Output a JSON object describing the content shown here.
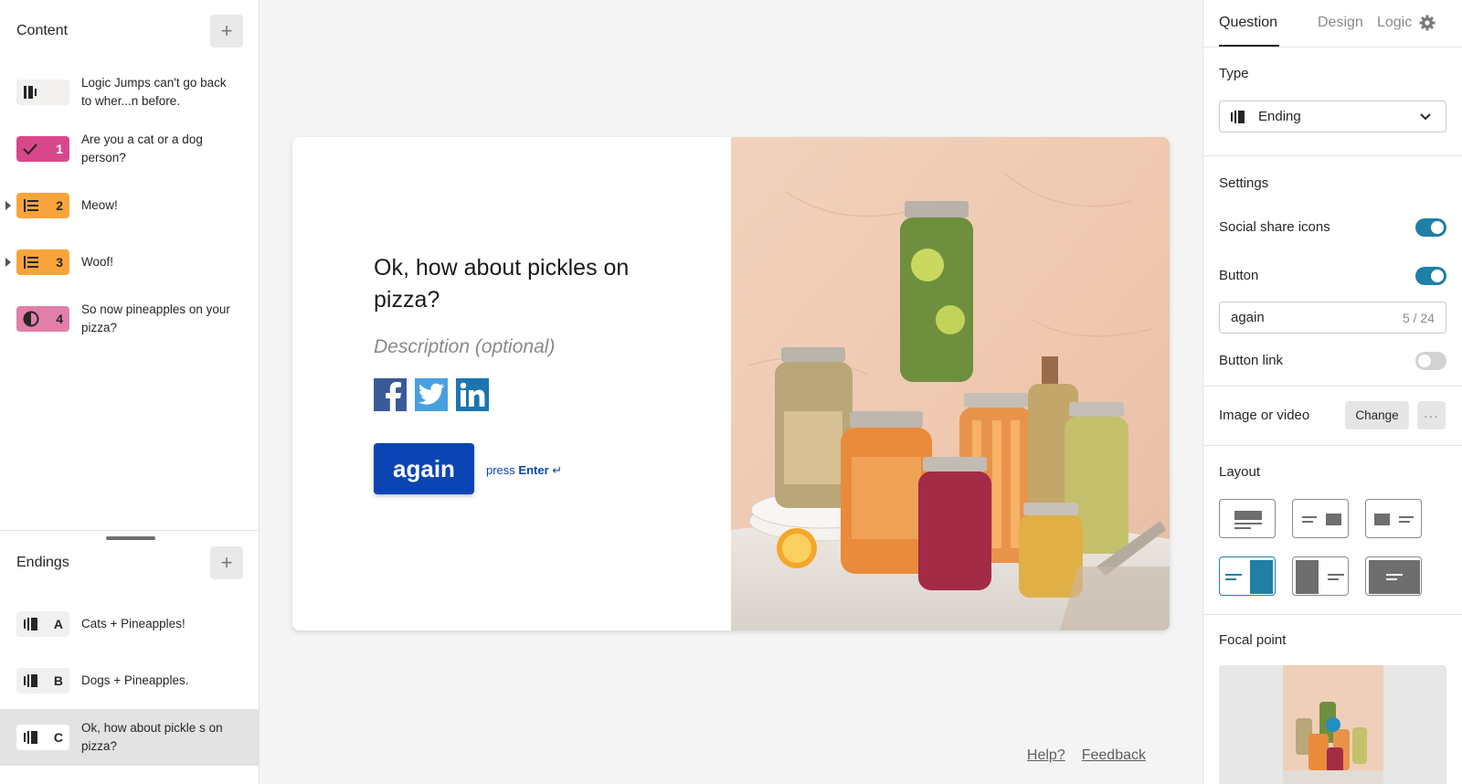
{
  "content_panel": {
    "title": "Content",
    "items": [
      {
        "number": "",
        "type": "statement-icon",
        "color": "#f1f0ef",
        "label": "Logic Jumps can't go back to wher...n before."
      },
      {
        "number": "1",
        "type": "check-icon",
        "color": "#d9478b",
        "label": "Are you a cat or a dog person?"
      },
      {
        "number": "2",
        "type": "list-icon",
        "color": "#f9a43a",
        "label": "Meow!"
      },
      {
        "number": "3",
        "type": "list-icon",
        "color": "#f9a43a",
        "label": "Woof!"
      },
      {
        "number": "4",
        "type": "contrast-icon",
        "color": "#e27fa8",
        "label": "So now pineapples on your pizza?"
      }
    ]
  },
  "endings_panel": {
    "title": "Endings",
    "items": [
      {
        "letter": "A",
        "label": "Cats + Pineapples!"
      },
      {
        "letter": "B",
        "label": "Dogs + Pineapples."
      },
      {
        "letter": "C",
        "label": "Ok, how about pickle s on pizza?",
        "selected": true
      }
    ]
  },
  "canvas": {
    "question": "Ok, how about pickles on pizza?",
    "description_placeholder": "Description (optional)",
    "social_icons": [
      "facebook-icon",
      "twitter-icon",
      "linkedin-icon"
    ],
    "button_label": "again",
    "press_prefix": "press",
    "press_key": "Enter",
    "press_symbol": "↵",
    "brand_color": "#0b45b4"
  },
  "footer": {
    "help": "Help?",
    "feedback": "Feedback"
  },
  "settings_panel": {
    "tabs": [
      "Question",
      "Design",
      "Logic"
    ],
    "active_tab": "Question",
    "type_label": "Type",
    "type_value": "Ending",
    "settings_label": "Settings",
    "social_share_label": "Social share icons",
    "social_share_on": true,
    "button_label": "Button",
    "button_on": true,
    "button_text_value": "again",
    "button_text_counter": "5 / 24",
    "button_link_label": "Button link",
    "button_link_on": false,
    "image_label": "Image or video",
    "change_label": "Change",
    "more_label": "···",
    "layout_label": "Layout",
    "layout_selected_index": 3,
    "focal_label": "Focal point",
    "accent_color": "#1f7fa6"
  }
}
